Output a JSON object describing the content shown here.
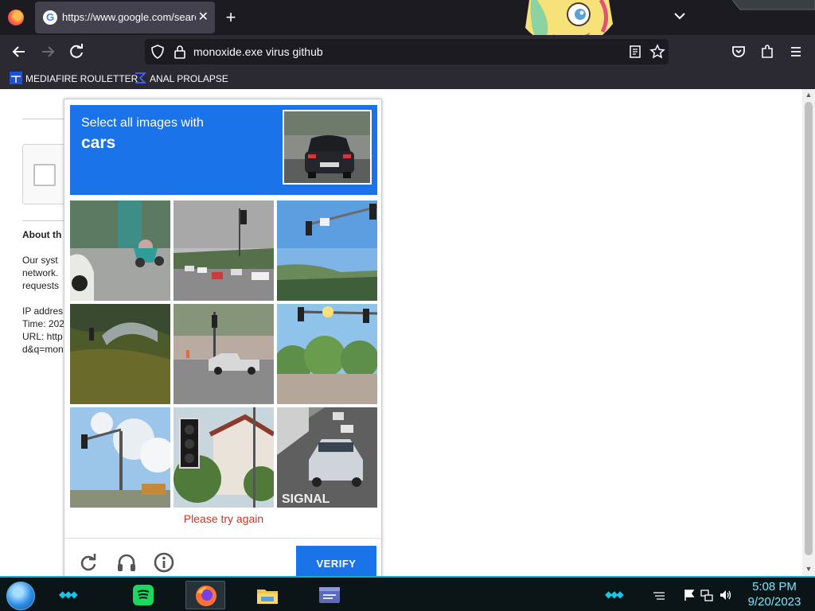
{
  "browser": {
    "tab_title": "https://www.google.com/search",
    "tab_close": "✕",
    "new_tab": "+",
    "url": "monoxide.exe virus github",
    "bookmarks": [
      {
        "label": "MEDIAFIRE ROULETTER",
        "icon": "mediafire-icon"
      },
      {
        "label": "ANAL PROLAPSE",
        "icon": "sigma-icon"
      }
    ]
  },
  "page": {
    "about_heading": "About th",
    "lines": [
      "Our syst",
      "network.",
      "requests",
      "",
      "IP addres",
      "Time: 202",
      "URL: http",
      "d&q=mon"
    ]
  },
  "captcha": {
    "instruction": "Select all images with",
    "target": "cars",
    "error": "Please try again",
    "verify_label": "VERIFY",
    "footer_icons": [
      "reload-icon",
      "audio-headphones-icon",
      "info-icon"
    ],
    "tiles": [
      {
        "id": 1,
        "content": "street with motorcycle and parked car"
      },
      {
        "id": 2,
        "content": "parking lot with cars and traffic light"
      },
      {
        "id": 3,
        "content": "traffic light over sky and trees"
      },
      {
        "id": 4,
        "content": "grassy hill with bridge"
      },
      {
        "id": 5,
        "content": "pickup truck and traffic light"
      },
      {
        "id": 6,
        "content": "traffic lights over trees"
      },
      {
        "id": 7,
        "content": "traffic light pole against clouds"
      },
      {
        "id": 8,
        "content": "traffic light near building"
      },
      {
        "id": 9,
        "content": "silver SUV on road with SIGNAL marking"
      }
    ]
  },
  "taskbar": {
    "time": "5:08 PM",
    "date": "9/20/2023",
    "apps": [
      "spotify-icon",
      "firefox-icon",
      "file-explorer-icon",
      "window-app-icon"
    ]
  },
  "colors": {
    "captcha_blue": "#1a73e8",
    "error_red": "#c0392b",
    "taskbar_accent": "#1fa7c8"
  }
}
